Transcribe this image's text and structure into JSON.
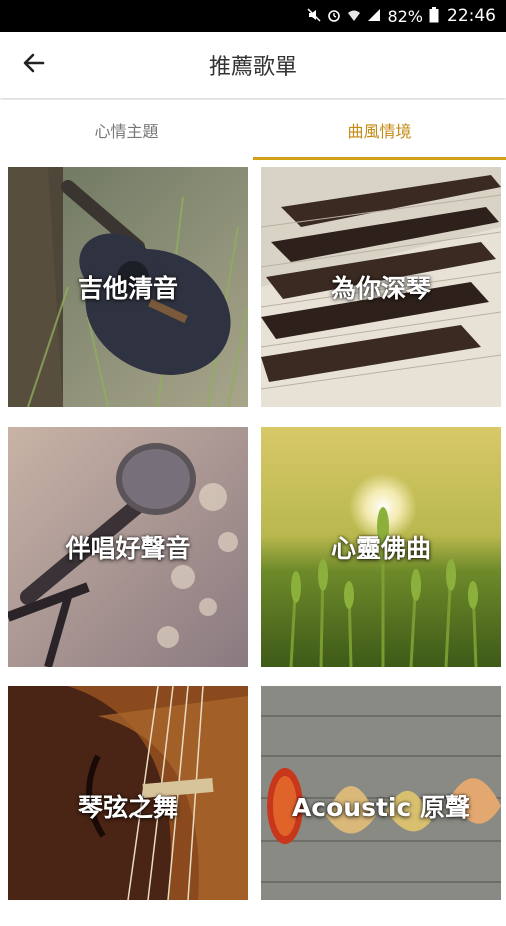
{
  "status_bar": {
    "battery": "82%",
    "time": "22:46"
  },
  "header": {
    "title": "推薦歌單",
    "back_icon": "arrow-left-icon"
  },
  "tabs": [
    {
      "label": "心情主題",
      "active": false
    },
    {
      "label": "曲風情境",
      "active": true
    }
  ],
  "accent_color": "#d4a017",
  "playlists": [
    {
      "label": "吉他清音"
    },
    {
      "label": "為你深琴"
    },
    {
      "label": "伴唱好聲音"
    },
    {
      "label": "心靈佛曲"
    },
    {
      "label": "琴弦之舞"
    },
    {
      "label": "Acoustic 原聲"
    }
  ]
}
